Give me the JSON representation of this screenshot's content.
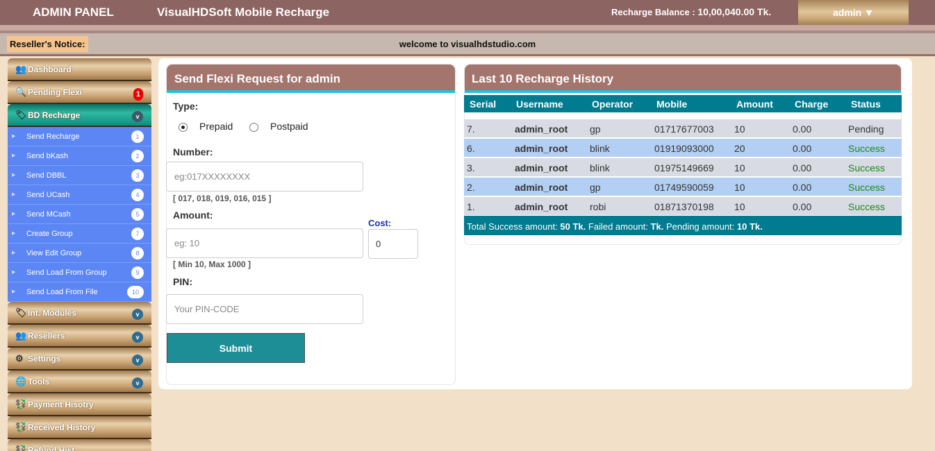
{
  "header": {
    "brand": "ADMIN PANEL",
    "app_title": "VisualHDSoft Mobile Recharge",
    "balance_label": "Recharge Balance :",
    "balance_value": "10,00,040.00 Tk.",
    "user_menu": "admin ▼"
  },
  "notice": {
    "label": "Reseller's Notice:",
    "message": "welcome to visualhdstudio.com"
  },
  "sidebar": {
    "items": [
      {
        "label": "Dashboard",
        "icon": "users-icon"
      },
      {
        "label": "Pending Flexi",
        "icon": "search-icon",
        "badge": "1"
      },
      {
        "label": "BD Recharge",
        "icon": "tag-icon",
        "chevron": "v"
      }
    ],
    "sub_items": [
      {
        "label": "Send Recharge",
        "num": "1"
      },
      {
        "label": "Send bKash",
        "num": "2"
      },
      {
        "label": "Send DBBL",
        "num": "3"
      },
      {
        "label": "Send UCash",
        "num": "4"
      },
      {
        "label": "Send MCash",
        "num": "5"
      },
      {
        "label": "Create Group",
        "num": "7"
      },
      {
        "label": "View Edit Group",
        "num": "8"
      },
      {
        "label": "Send Load From Group",
        "num": "9"
      },
      {
        "label": "Send Load From File",
        "num": "10"
      }
    ],
    "lower_items": [
      {
        "label": "Int. Modules",
        "icon": "tag-icon",
        "chevron": "v"
      },
      {
        "label": "Resellers",
        "icon": "users-icon",
        "chevron": "v"
      },
      {
        "label": "Settings",
        "icon": "gear-icon",
        "chevron": "v"
      },
      {
        "label": "Tools",
        "icon": "globe-icon",
        "chevron": "v"
      },
      {
        "label": "Payment Hisotry",
        "icon": "money-icon"
      },
      {
        "label": "Received History",
        "icon": "money-icon"
      },
      {
        "label": "Refund Hist...",
        "icon": "money-icon"
      }
    ]
  },
  "form": {
    "title": "Send Flexi Request for admin",
    "type_label": "Type:",
    "prepaid_label": "Prepaid",
    "postpaid_label": "Postpaid",
    "selected_type": "Prepaid",
    "number_label": "Number:",
    "number_placeholder": "eg:017XXXXXXXX",
    "number_hint": "[ 017, 018, 019, 016, 015 ]",
    "amount_label": "Amount:",
    "amount_placeholder": "eg: 10",
    "amount_hint": "[ Min 10, Max 1000 ]",
    "cost_label": "Cost:",
    "cost_value": "0",
    "pin_label": "PIN:",
    "pin_placeholder": "Your PIN-CODE",
    "submit_label": "Submit"
  },
  "history": {
    "title": "Last 10 Recharge History",
    "columns": [
      "Serial",
      "Username",
      "Operator",
      "Mobile",
      "Amount",
      "Charge",
      "Status"
    ],
    "rows": [
      {
        "serial": "7.",
        "username": "admin_root",
        "operator": "gp",
        "mobile": "01717677003",
        "amount": "10",
        "charge": "0.00",
        "status": "Pending"
      },
      {
        "serial": "6.",
        "username": "admin_root",
        "operator": "blink",
        "mobile": "01919093000",
        "amount": "20",
        "charge": "0.00",
        "status": "Success"
      },
      {
        "serial": "3.",
        "username": "admin_root",
        "operator": "blink",
        "mobile": "01975149669",
        "amount": "10",
        "charge": "0.00",
        "status": "Success"
      },
      {
        "serial": "2.",
        "username": "admin_root",
        "operator": "gp",
        "mobile": "01749590059",
        "amount": "10",
        "charge": "0.00",
        "status": "Success"
      },
      {
        "serial": "1.",
        "username": "admin_root",
        "operator": "robi",
        "mobile": "01871370198",
        "amount": "10",
        "charge": "0.00",
        "status": "Success"
      }
    ],
    "summary": {
      "success_label": "Total Success amount:",
      "success_value": "50 Tk.",
      "failed_label": "Failed amount:",
      "failed_value": "Tk.",
      "pending_label": "Pending amount:",
      "pending_value": "10 Tk."
    }
  },
  "colors": {
    "header": "#8c6461",
    "card_header": "#a3756c",
    "accent": "#23c0e0",
    "table_header": "#007b8f",
    "submit": "#1e8e96",
    "sub_menu": "#5c86f4",
    "success": "#1a8a1a"
  }
}
